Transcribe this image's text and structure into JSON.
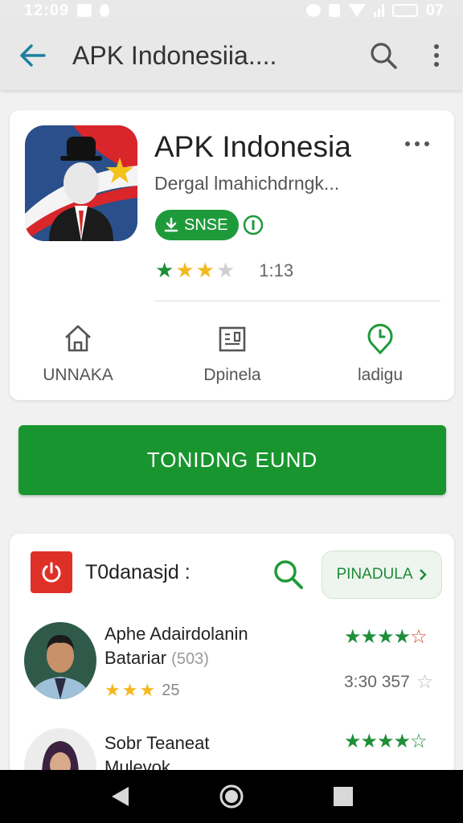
{
  "status_bar": {
    "time": "12:09",
    "battery": "07"
  },
  "app_bar": {
    "title": "APK Indonesiia....",
    "back_icon": "arrow-left-icon",
    "search_icon": "search-icon",
    "menu_icon": "more-vert-icon"
  },
  "app": {
    "name": "APK Indonesia",
    "subtitle": "Dergal lmahichdrngk...",
    "badge_label": "SNSE",
    "rating_stars": 3,
    "rating_count": "1:13",
    "quick_actions": [
      {
        "label": "UNNAKA",
        "icon": "home-icon"
      },
      {
        "label": "Dpinela",
        "icon": "document-icon"
      },
      {
        "label": "ladigu",
        "icon": "map-pin-icon"
      }
    ]
  },
  "install_button": {
    "label": "TONIDNG EUND"
  },
  "reviews": {
    "title": "T0danasjd :",
    "filter_label": "PINADULA",
    "items": [
      {
        "name": "Aphe Adairdolanin",
        "name_line2": "Batariar",
        "name_muted": "(503)",
        "stars": 3,
        "count": "25",
        "right_stars": 4,
        "meta": "3:30 357"
      },
      {
        "name": "Sobr Teaneat",
        "name_line2": "Mulevok",
        "name_muted": "",
        "stars": 0,
        "count": "",
        "right_stars": 4,
        "meta": ""
      }
    ]
  },
  "colors": {
    "brand_green": "#19952f",
    "accent_blue": "#1f7f9e",
    "star_yellow": "#f2b81e",
    "review_red": "#df3028"
  }
}
